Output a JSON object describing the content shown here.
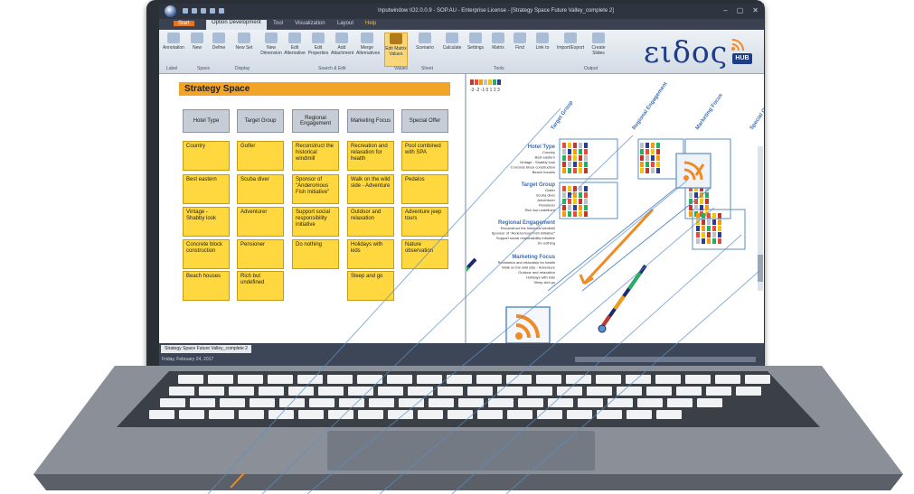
{
  "window": {
    "title": "Inputwindow IO2.0.0.9 - SOP.AU - Enterprise License - [Strategy Space Future Valley_complete 2]",
    "controls": [
      "–",
      "▢",
      "✕"
    ]
  },
  "ribbon_tabs": [
    {
      "label": "Start"
    },
    {
      "label": "Option Development"
    },
    {
      "label": "Tool"
    },
    {
      "label": "Visualization"
    },
    {
      "label": "Layout"
    },
    {
      "label": "Help"
    }
  ],
  "ribbon_buttons": [
    {
      "label": "Annotation"
    },
    {
      "label": "New"
    },
    {
      "label": "Define"
    },
    {
      "label": "New Set"
    },
    {
      "label": "New Dimension"
    },
    {
      "label": "Edit Alternative"
    },
    {
      "label": "Edit Properties"
    },
    {
      "label": "Add Attachment"
    },
    {
      "label": "Merge Alternatives"
    },
    {
      "label": "Edit Matrix Values"
    },
    {
      "label": "Scenario"
    },
    {
      "label": "Calculate"
    },
    {
      "label": "Settings"
    },
    {
      "label": "Matrix"
    },
    {
      "label": "Find"
    },
    {
      "label": "Link to"
    },
    {
      "label": "Import/Export"
    },
    {
      "label": "Create Slides"
    }
  ],
  "ribbon_groups": [
    "Label",
    "Space",
    "Display",
    "Search & Edit",
    "Values",
    "Sheet",
    "Tools",
    "Output"
  ],
  "logo": {
    "word": "ειδος",
    "badge": "HUB",
    "color": "#1f3d86"
  },
  "strategy_space": {
    "title": "Strategy Space",
    "columns": [
      {
        "header": "Hotel Type",
        "cards": [
          "Country",
          "Best eastern",
          "Vintage - Shabby look",
          "Concrete block construction",
          "Beach houses"
        ]
      },
      {
        "header": "Target Group",
        "cards": [
          "Golfer",
          "Scuba diver",
          "Adventurer",
          "Pensioner",
          "Rich but undefined"
        ]
      },
      {
        "header": "Regional Engagement",
        "cards": [
          "Reconstruct the historical windmill",
          "Sponsor of \"Anderomous Fish Initiative\"",
          "Support social responsibility initiative",
          "Do nothing"
        ]
      },
      {
        "header": "Marketing Focus",
        "cards": [
          "Recreation and relaxation for health",
          "Walk on the wild side - Adventure",
          "Outdoor and relaxation",
          "Holidays with kids",
          "Sleep and go"
        ]
      },
      {
        "header": "Special Offer",
        "cards": [
          "Pool combined with SPA",
          "Pedalos",
          "Adventure jeep tours",
          "Nature observation"
        ]
      }
    ]
  },
  "matrix": {
    "legend_values": "-3 -2 -1 0 1 2 3",
    "column_groups": [
      "Target Group",
      "Regional Engagement",
      "Marketing Focus",
      "Special Offer"
    ],
    "row_groups": [
      {
        "title": "Hotel Type",
        "items": [
          "Country",
          "Best eastern",
          "Vintage - Shabby look",
          "Concrete block construction",
          "Beach houses"
        ]
      },
      {
        "title": "Target Group",
        "items": [
          "Golfer",
          "Scuba diver",
          "Adventurer",
          "Pensioner",
          "Rich but undefined"
        ]
      },
      {
        "title": "Regional Engagement",
        "items": [
          "Reconstruct the historical windmill",
          "Sponsor of \"Anderomous Fish Initiative\"",
          "Support social responsibility initiative",
          "Do nothing"
        ]
      },
      {
        "title": "Marketing Focus",
        "items": [
          "Recreation and relaxation for health",
          "Walk on the wild side - Adventure",
          "Outdoor and relaxation",
          "Holidays with kids",
          "Sleep and go"
        ]
      }
    ],
    "legend_colors": [
      "#c0392b",
      "#e74c3c",
      "#f39c12",
      "#bdc3c7",
      "#f1c40f",
      "#27ae60",
      "#2c3e91"
    ],
    "accent_color": "#f08a24",
    "highlight_color": "#5b8fc7"
  },
  "statusbar": {
    "doc_tab": "Strategy Space Future Valley_complete 2",
    "date": "Friday, February 24, 2017"
  }
}
